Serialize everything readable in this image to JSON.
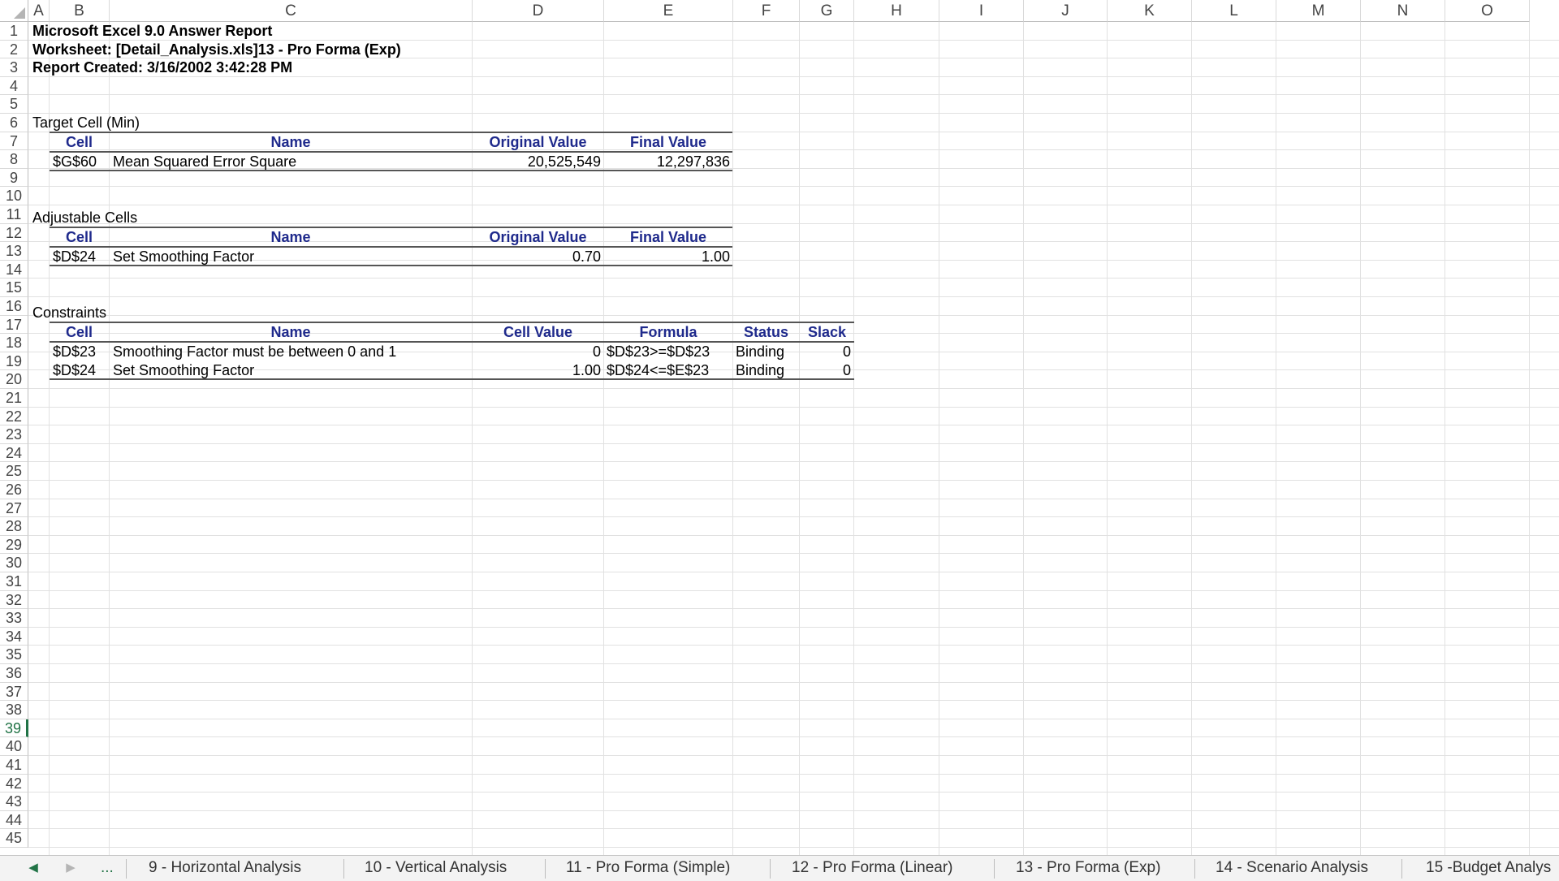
{
  "columns": [
    "A",
    "B",
    "C",
    "D",
    "E",
    "F",
    "G",
    "H",
    "I",
    "J",
    "K",
    "L",
    "M",
    "N",
    "O"
  ],
  "rows": [
    "1",
    "2",
    "3",
    "4",
    "5",
    "6",
    "7",
    "8",
    "9",
    "10",
    "11",
    "12",
    "13",
    "14",
    "15",
    "16",
    "17",
    "18",
    "19",
    "20",
    "21",
    "22",
    "23",
    "24",
    "25",
    "26",
    "27",
    "28",
    "29",
    "30",
    "31",
    "32",
    "33",
    "34",
    "35",
    "36",
    "37",
    "38",
    "39",
    "40",
    "41",
    "42",
    "43",
    "44",
    "45"
  ],
  "active_row": "39",
  "report": {
    "title": "Microsoft Excel 9.0 Answer Report",
    "worksheet": "Worksheet: [Detail_Analysis.xls]13 - Pro Forma (Exp)",
    "created": "Report Created: 3/16/2002 3:42:28 PM"
  },
  "target": {
    "section_label": "Target Cell (Min)",
    "headers": [
      "Cell",
      "Name",
      "Original Value",
      "Final Value"
    ],
    "rows": [
      [
        "$G$60",
        "Mean Squared Error  Square",
        "20,525,549",
        "12,297,836"
      ]
    ]
  },
  "adjustable": {
    "section_label": "Adjustable Cells",
    "headers": [
      "Cell",
      "Name",
      "Original Value",
      "Final Value"
    ],
    "rows": [
      [
        "$D$24",
        "Set Smoothing Factor",
        "0.70",
        "1.00"
      ]
    ]
  },
  "constraints": {
    "section_label": "Constraints",
    "headers": [
      "Cell",
      "Name",
      "Cell Value",
      "Formula",
      "Status",
      "Slack"
    ],
    "rows": [
      [
        "$D$23",
        "Smoothing Factor must be between 0 and 1",
        "0",
        "$D$23>=$D$23",
        "Binding",
        "0"
      ],
      [
        "$D$24",
        "Set Smoothing Factor",
        "1.00",
        "$D$24<=$E$23",
        "Binding",
        "0"
      ]
    ]
  },
  "sheet_tabs": {
    "more": "...",
    "items": [
      "9 - Horizontal Analysis",
      "10 - Vertical Analysis",
      "11 - Pro Forma (Simple)",
      "12 - Pro Forma (Linear)",
      "13 - Pro Forma (Exp)",
      "14 - Scenario Analysis",
      "15 -Budget Analys"
    ]
  },
  "icons": {
    "prev_sheet": "triangle-left-icon",
    "next_sheet": "triangle-right-icon",
    "select_all": "select-all-triangle-icon"
  },
  "colors": {
    "header_text": "#1f2a8c",
    "accent": "#217346"
  }
}
